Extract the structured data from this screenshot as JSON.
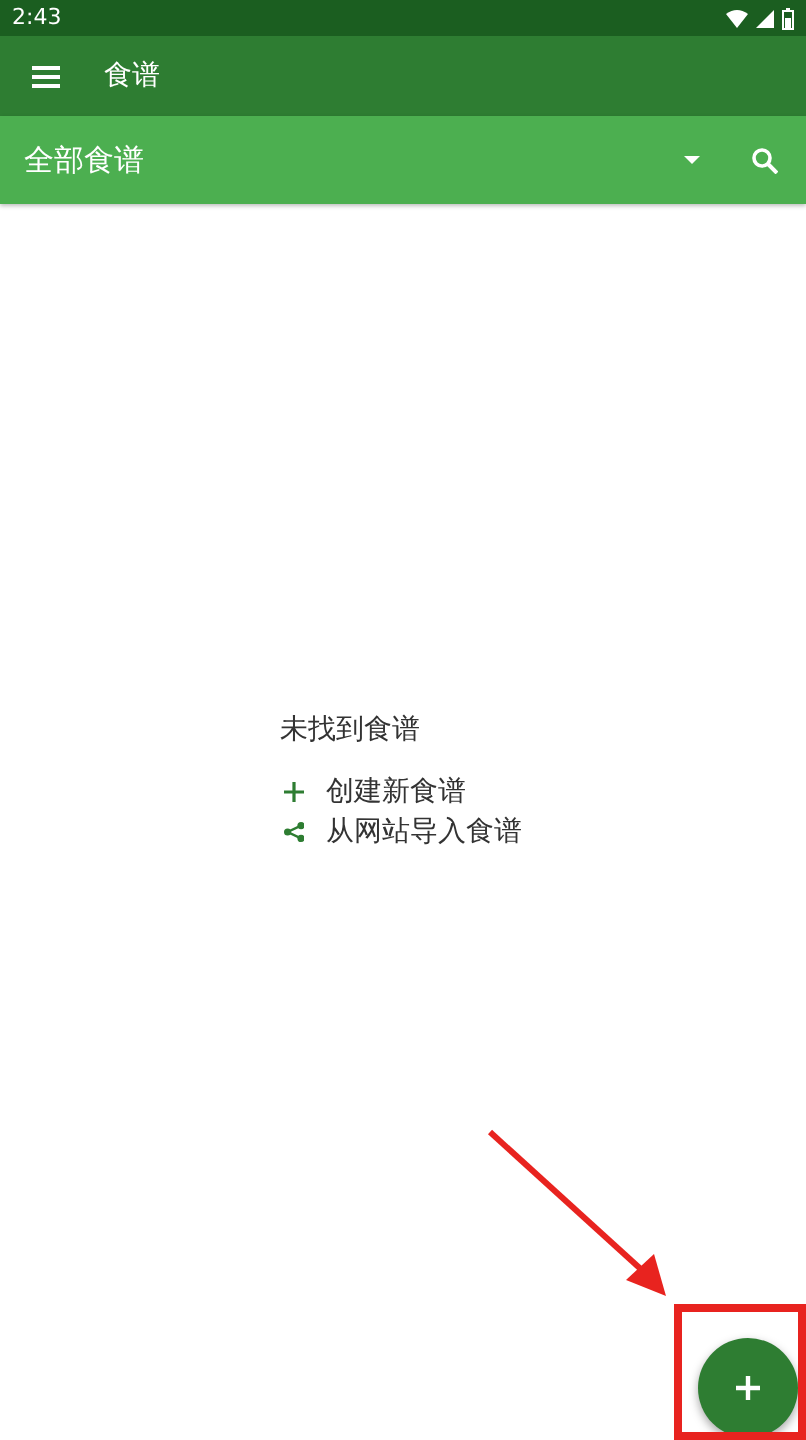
{
  "status_bar": {
    "time": "2:43"
  },
  "toolbar": {
    "title": "食谱"
  },
  "filter_bar": {
    "selected_filter": "全部食谱"
  },
  "empty_state": {
    "message": "未找到食谱",
    "actions": [
      {
        "kind": "create",
        "label": "创建新食谱"
      },
      {
        "kind": "import",
        "label": "从网站导入食谱"
      }
    ]
  }
}
